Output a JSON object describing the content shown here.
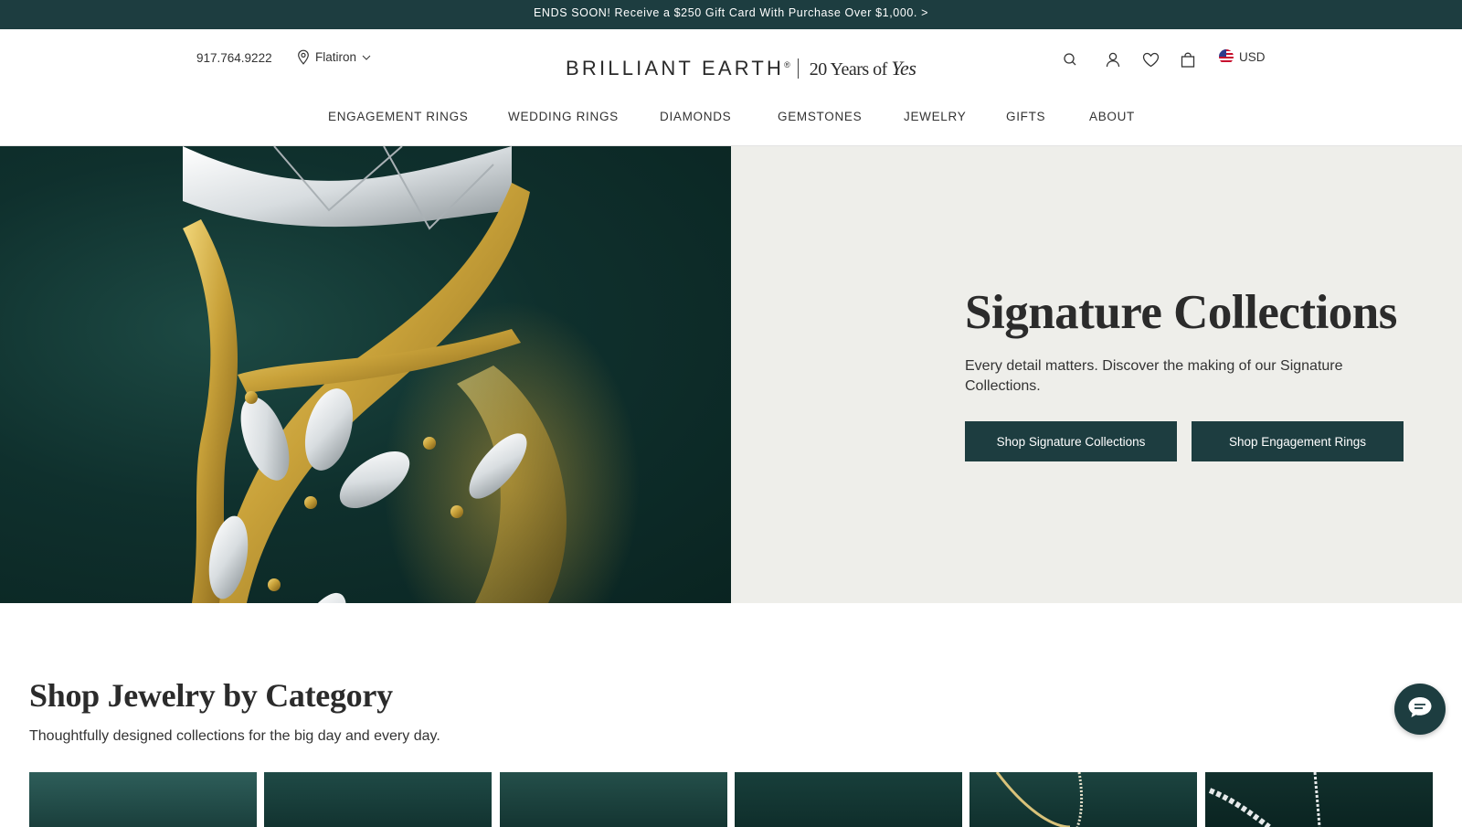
{
  "promo": {
    "text": "ENDS SOON! Receive a $250 Gift Card With Purchase Over $1,000. >"
  },
  "header": {
    "phone": "917.764.9222",
    "store": "Flatiron",
    "logo_word": "BRILLIANT EARTH",
    "logo_mark": "®",
    "logo_tag": "20 Years of ",
    "logo_tag_script": "Yes",
    "currency": "USD"
  },
  "nav": {
    "items": [
      {
        "label": "ENGAGEMENT RINGS"
      },
      {
        "label": "WEDDING RINGS"
      },
      {
        "label": "DIAMONDS"
      },
      {
        "label": "GEMSTONES"
      },
      {
        "label": "JEWELRY"
      },
      {
        "label": "GIFTS"
      },
      {
        "label": "ABOUT"
      }
    ]
  },
  "hero": {
    "title": "Signature Collections",
    "subtitle": "Every detail matters. Discover the making of our Signature Collections.",
    "button_primary": "Shop Signature Collections",
    "button_secondary": "Shop Engagement Rings"
  },
  "category": {
    "title": "Shop Jewelry by Category",
    "subtitle": "Thoughtfully designed collections for the big day and every day."
  },
  "colors": {
    "brand": "#1d3d40",
    "hero_panel": "#eeeeea",
    "gold": "#c9a23a"
  }
}
